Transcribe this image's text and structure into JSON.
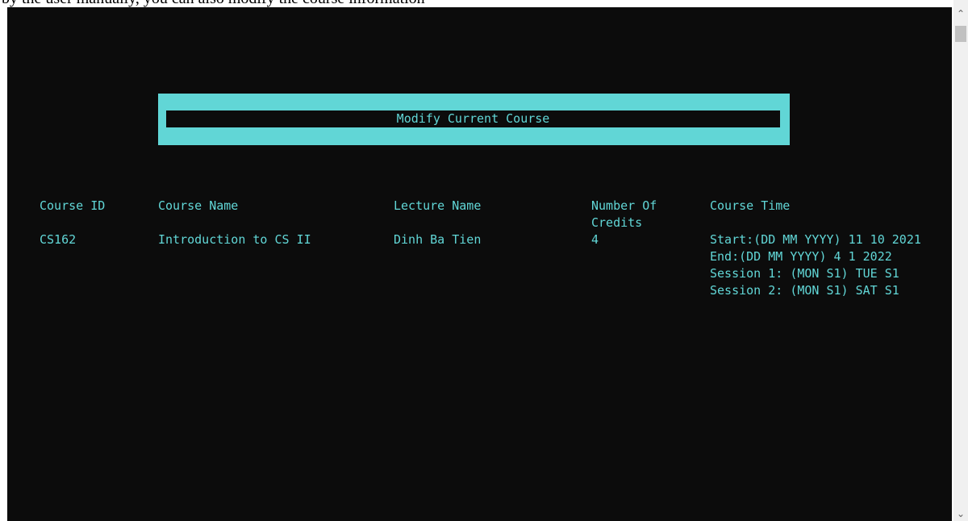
{
  "page_caption": "by the user manually, you can also modify the course information",
  "banner": {
    "title": "Modify Current Course"
  },
  "table": {
    "headers": {
      "course_id": "Course ID",
      "course_name": "Course Name",
      "lecture_name": "Lecture Name",
      "credits_line1": "Number Of",
      "credits_line2": "Credits",
      "course_time": "Course Time"
    },
    "row": {
      "course_id": "CS162",
      "course_name": "Introduction to CS II",
      "lecture_name": "Dinh Ba Tien",
      "credits": "4",
      "time_start": "Start:(DD MM YYYY) 11 10 2021",
      "time_end": "End:(DD MM YYYY) 4 1 2022",
      "session1": "Session 1: (MON S1) TUE S1",
      "session2": "Session 2: (MON S1) SAT S1"
    }
  },
  "scrollbar": {
    "up_icon": "chevron-up-icon",
    "down_icon": "chevron-down-icon"
  },
  "colors": {
    "console_background": "#0c0c0c",
    "console_text": "#61d6d6",
    "page_background": "#ffffff"
  }
}
